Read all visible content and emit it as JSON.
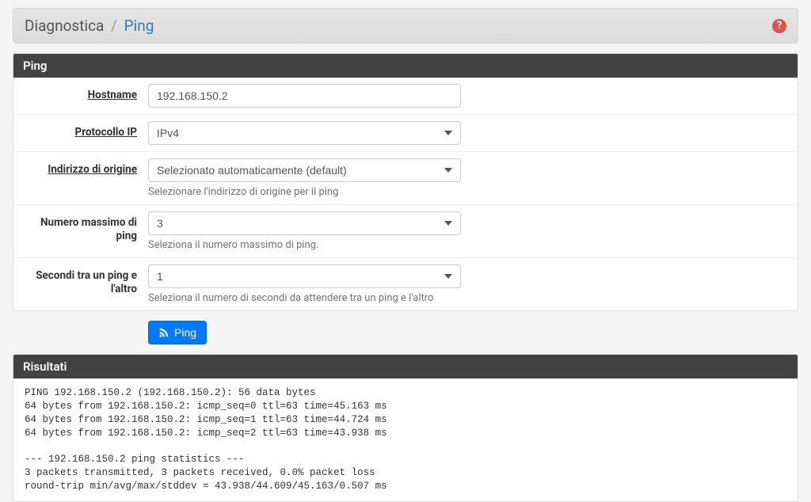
{
  "breadcrumb": {
    "parent": "Diagnostica",
    "current": "Ping"
  },
  "help_icon_text": "?",
  "panel_ping": {
    "title": "Ping"
  },
  "fields": {
    "hostname": {
      "label": "Hostname",
      "value": "192.168.150.2"
    },
    "protocol": {
      "label": "Protocollo IP",
      "value": "IPv4"
    },
    "source": {
      "label": "Indirizzo di origine",
      "value": "Selezionato automaticamente (default)",
      "help": "Selezionare l'indirizzo di origine per il ping"
    },
    "count": {
      "label": "Numero massimo di ping",
      "value": "3",
      "help": "Seleziona il numero massimo di ping."
    },
    "interval": {
      "label": "Secondi tra un ping e l'altro",
      "value": "1",
      "help": "Seleziona il numero di secondi da attendere tra un ping e l'altro"
    }
  },
  "button": {
    "label": "Ping"
  },
  "panel_results": {
    "title": "Risultati"
  },
  "results_text": "PING 192.168.150.2 (192.168.150.2): 56 data bytes\n64 bytes from 192.168.150.2: icmp_seq=0 ttl=63 time=45.163 ms\n64 bytes from 192.168.150.2: icmp_seq=1 ttl=63 time=44.724 ms\n64 bytes from 192.168.150.2: icmp_seq=2 ttl=63 time=43.938 ms\n\n--- 192.168.150.2 ping statistics ---\n3 packets transmitted, 3 packets received, 0.0% packet loss\nround-trip min/avg/max/stddev = 43.938/44.609/45.163/0.507 ms"
}
